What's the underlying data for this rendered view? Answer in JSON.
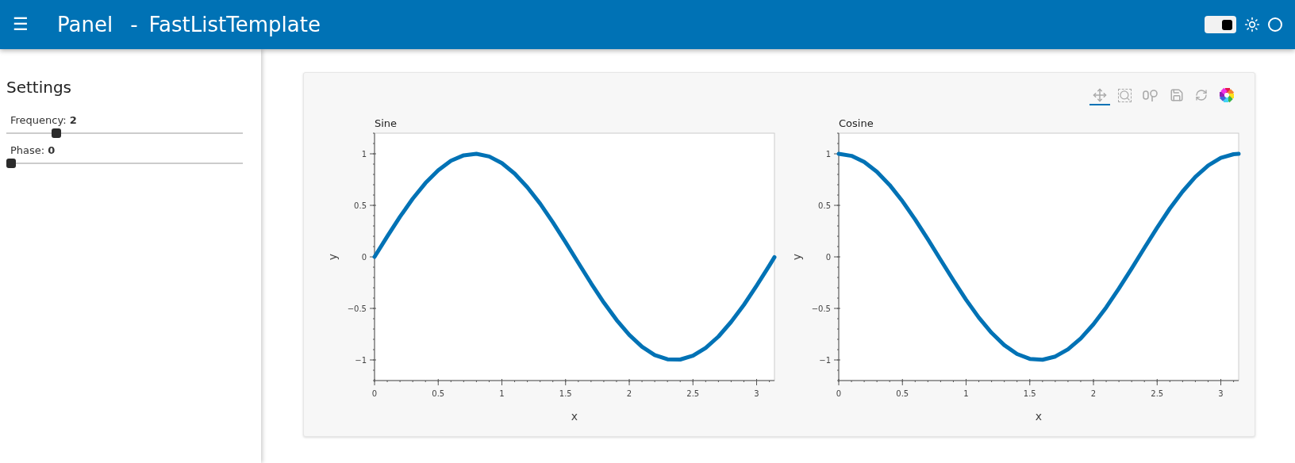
{
  "header": {
    "menu_icon": "☰",
    "title": "Panel",
    "separator": "-",
    "subtitle": "FastListTemplate",
    "theme_toggle": {
      "on": true
    }
  },
  "sidebar": {
    "title": "Settings",
    "sliders": [
      {
        "label": "Frequency:",
        "value": "2",
        "level": 0.2
      },
      {
        "label": "Phase:",
        "value": "0",
        "level": 0
      }
    ]
  },
  "toolbar": {
    "tools": [
      {
        "kind": "pan",
        "selected": true
      },
      {
        "kind": "box_zoom",
        "selected": false
      },
      {
        "kind": "wheel_zoom",
        "selected": false
      },
      {
        "kind": "save",
        "selected": false
      },
      {
        "kind": "reset",
        "selected": false
      },
      {
        "kind": "logo",
        "selected": false
      }
    ]
  },
  "charts": [
    {
      "chart_data": {
        "type": "line",
        "title": "Sine",
        "xlabel": "x",
        "ylabel": "y",
        "xlim": [
          0,
          3.14
        ],
        "ylim": [
          -1.2,
          1.2
        ],
        "xticks": [
          0,
          0.5,
          1,
          1.5,
          2,
          2.5,
          3
        ],
        "yticks": [
          -1,
          -0.5,
          0,
          0.5,
          1
        ],
        "x": [
          0,
          0.1,
          0.2,
          0.3,
          0.4,
          0.5,
          0.6,
          0.7,
          0.8,
          0.9,
          1.0,
          1.1,
          1.2,
          1.3,
          1.4,
          1.5,
          1.6,
          1.7,
          1.8,
          1.9,
          2.0,
          2.1,
          2.2,
          2.3,
          2.4,
          2.5,
          2.6,
          2.7,
          2.8,
          2.9,
          3.0,
          3.1,
          3.14
        ],
        "series": [
          {
            "color": "#0072b5",
            "values": [
              0,
              0.199,
              0.389,
              0.565,
              0.717,
              0.841,
              0.932,
              0.985,
              1.0,
              0.974,
              0.909,
              0.808,
              0.675,
              0.516,
              0.335,
              0.141,
              -0.058,
              -0.256,
              -0.443,
              -0.612,
              -0.757,
              -0.872,
              -0.952,
              -0.994,
              -0.996,
              -0.959,
              -0.883,
              -0.773,
              -0.631,
              -0.465,
              -0.279,
              -0.083,
              -0.003
            ]
          }
        ]
      }
    },
    {
      "chart_data": {
        "type": "line",
        "title": "Cosine",
        "xlabel": "x",
        "ylabel": "y",
        "xlim": [
          0,
          3.14
        ],
        "ylim": [
          -1.2,
          1.2
        ],
        "xticks": [
          0,
          0.5,
          1,
          1.5,
          2,
          2.5,
          3
        ],
        "yticks": [
          -1,
          -0.5,
          0,
          0.5,
          1
        ],
        "x": [
          0,
          0.1,
          0.2,
          0.3,
          0.4,
          0.5,
          0.6,
          0.7,
          0.8,
          0.9,
          1.0,
          1.1,
          1.2,
          1.3,
          1.4,
          1.5,
          1.6,
          1.7,
          1.8,
          1.9,
          2.0,
          2.1,
          2.2,
          2.3,
          2.4,
          2.5,
          2.6,
          2.7,
          2.8,
          2.9,
          3.0,
          3.1,
          3.14
        ],
        "series": [
          {
            "color": "#0072b5",
            "values": [
              1,
              0.98,
              0.921,
              0.825,
              0.697,
              0.54,
              0.362,
              0.17,
              -0.029,
              -0.227,
              -0.416,
              -0.589,
              -0.737,
              -0.857,
              -0.942,
              -0.99,
              -0.998,
              -0.967,
              -0.897,
              -0.791,
              -0.654,
              -0.49,
              -0.307,
              -0.112,
              0.087,
              0.284,
              0.469,
              0.635,
              0.776,
              0.886,
              0.96,
              0.996,
              1.0
            ]
          }
        ]
      }
    }
  ]
}
